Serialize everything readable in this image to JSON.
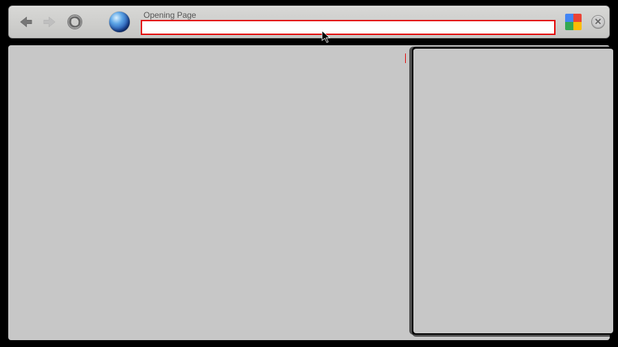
{
  "toolbar": {
    "back_icon": "back",
    "forward_icon": "forward",
    "reload_icon": "reload",
    "home_icon": "globe",
    "url_label": "Opening Page",
    "url_value": "",
    "maps_icon": "google-maps",
    "close_icon": "close"
  },
  "content": {
    "status": "loading",
    "popup_visible": true
  },
  "colors": {
    "highlight": "#e30000",
    "toolbar_bg": "#cccccc",
    "page_bg": "#c7c7c7"
  }
}
